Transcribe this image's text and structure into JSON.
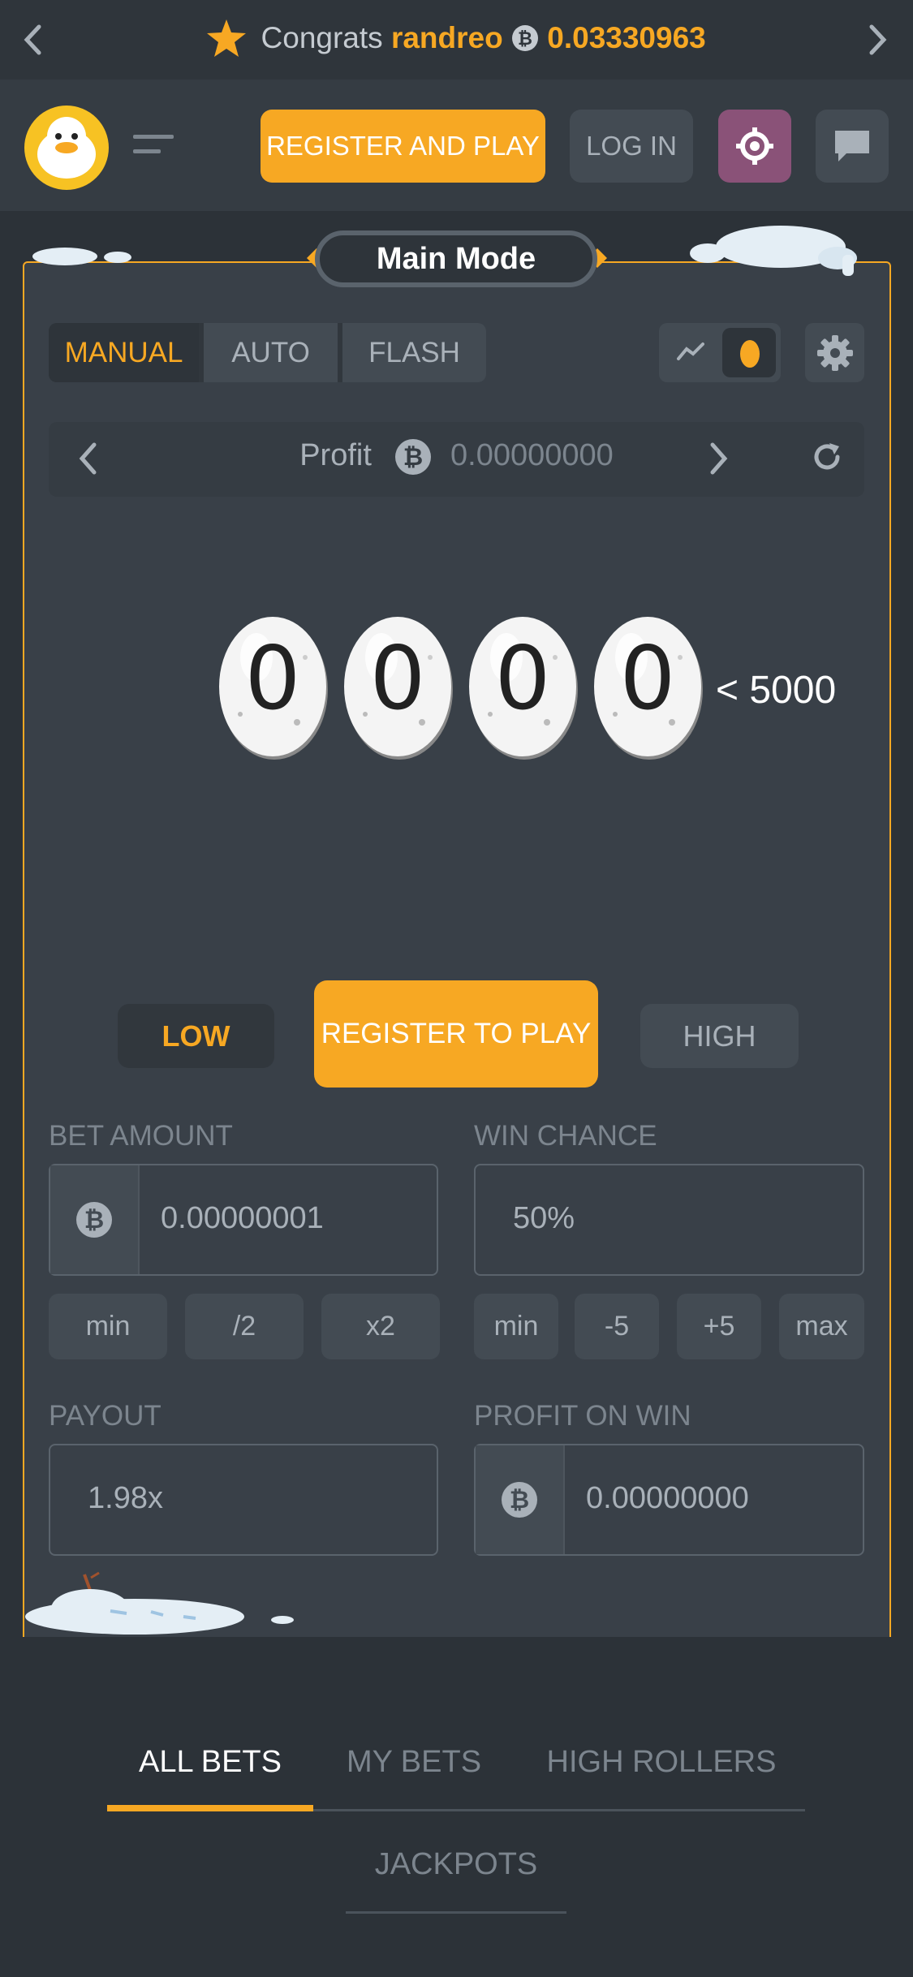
{
  "ticker": {
    "prefix": "Congrats",
    "user": "randreo",
    "amount": "0.03330963"
  },
  "header": {
    "register_label": "REGISTER AND PLAY",
    "login_label": "LOG IN"
  },
  "mode": {
    "title": "Main Mode"
  },
  "tabs": {
    "manual": "MANUAL",
    "auto": "AUTO",
    "flash": "FLASH"
  },
  "profit": {
    "label": "Profit",
    "value": "0.00000000"
  },
  "roll": {
    "digits": [
      "0",
      "0",
      "0",
      "0"
    ],
    "target": "< 5000"
  },
  "actions": {
    "low": "LOW",
    "play": "REGISTER TO PLAY",
    "high": "HIGH"
  },
  "bet": {
    "label": "BET AMOUNT",
    "value": "0.00000001",
    "buttons": [
      "min",
      "/2",
      "x2"
    ]
  },
  "chance": {
    "label": "WIN CHANCE",
    "value": "50%",
    "buttons": [
      "min",
      "-5",
      "+5",
      "max"
    ]
  },
  "payout": {
    "label": "PAYOUT",
    "value": "1.98x"
  },
  "profit_on_win": {
    "label": "PROFIT ON WIN",
    "value": "0.00000000"
  },
  "bets_tabs": {
    "all": "ALL BETS",
    "mine": "MY BETS",
    "high": "HIGH ROLLERS",
    "jackpots": "JACKPOTS"
  },
  "colors": {
    "accent": "#f7a823",
    "background": "#2c3238",
    "panel": "#394048",
    "button": "#434b53"
  }
}
